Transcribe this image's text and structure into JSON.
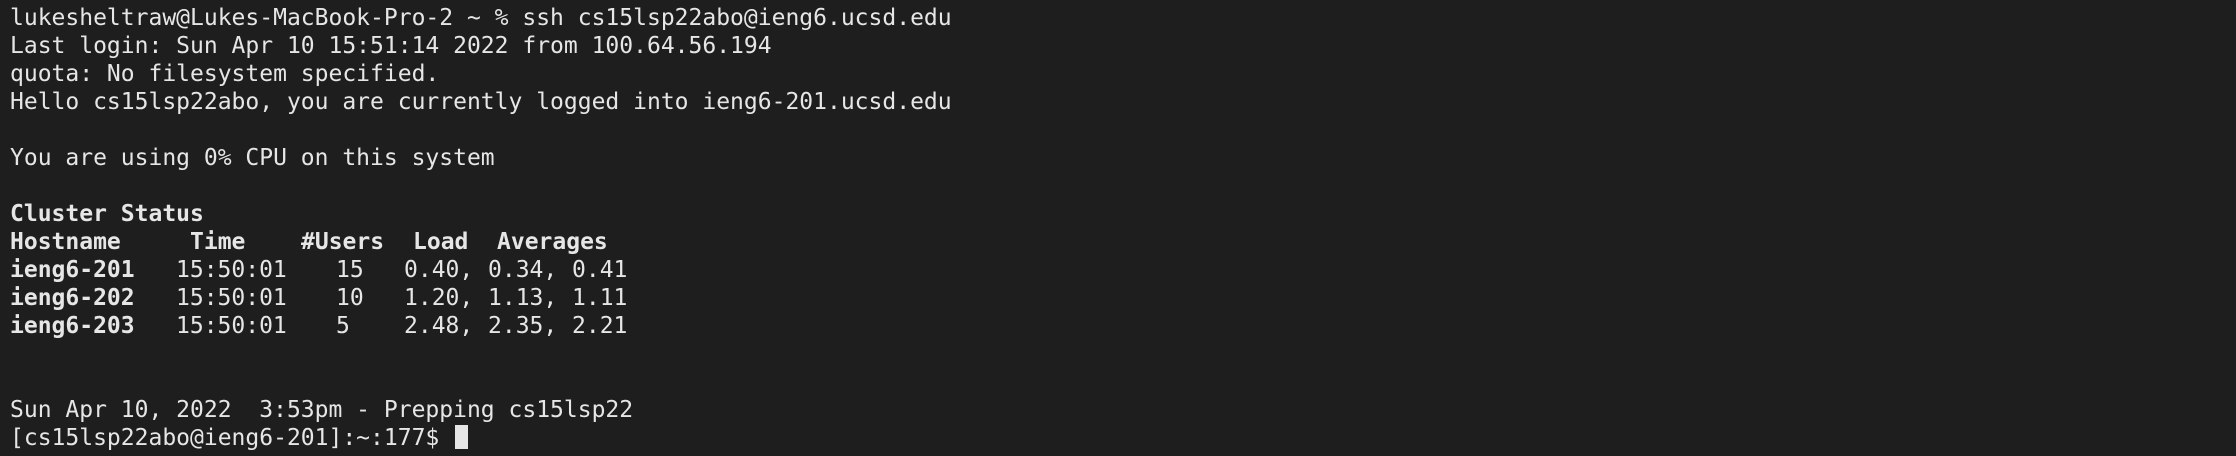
{
  "terminal": {
    "prompt_line": "lukesheltraw@Lukes-MacBook-Pro-2 ~ % ssh cs15lsp22abo@ieng6.ucsd.edu",
    "last_login": "Last login: Sun Apr 10 15:51:14 2022 from 100.64.56.194",
    "quota": "quota: No filesystem specified.",
    "hello": "Hello cs15lsp22abo, you are currently logged into ieng6-201.ucsd.edu",
    "cpu": "You are using 0% CPU on this system",
    "cluster_title": "Cluster Status",
    "table_headers": {
      "hostname": "Hostname",
      "time": "Time",
      "users": "#Users",
      "load": "Load",
      "averages": "Averages"
    },
    "rows": [
      {
        "host": "ieng6-201",
        "time": "15:50:01",
        "users": "15",
        "a1": "0.40,",
        "a2": "0.34,",
        "a3": "0.41"
      },
      {
        "host": "ieng6-202",
        "time": "15:50:01",
        "users": "10",
        "a1": "1.20,",
        "a2": "1.13,",
        "a3": "1.11"
      },
      {
        "host": "ieng6-203",
        "time": "15:50:01",
        "users": "5",
        "a1": "2.48,",
        "a2": "2.35,",
        "a3": "2.21"
      }
    ],
    "date_line": "Sun Apr 10, 2022  3:53pm - Prepping cs15lsp22",
    "remote_prompt": "[cs15lsp22abo@ieng6-201]:~:177$ "
  },
  "colors": {
    "background": "#1e1e1e",
    "foreground": "#e6e6e6"
  }
}
